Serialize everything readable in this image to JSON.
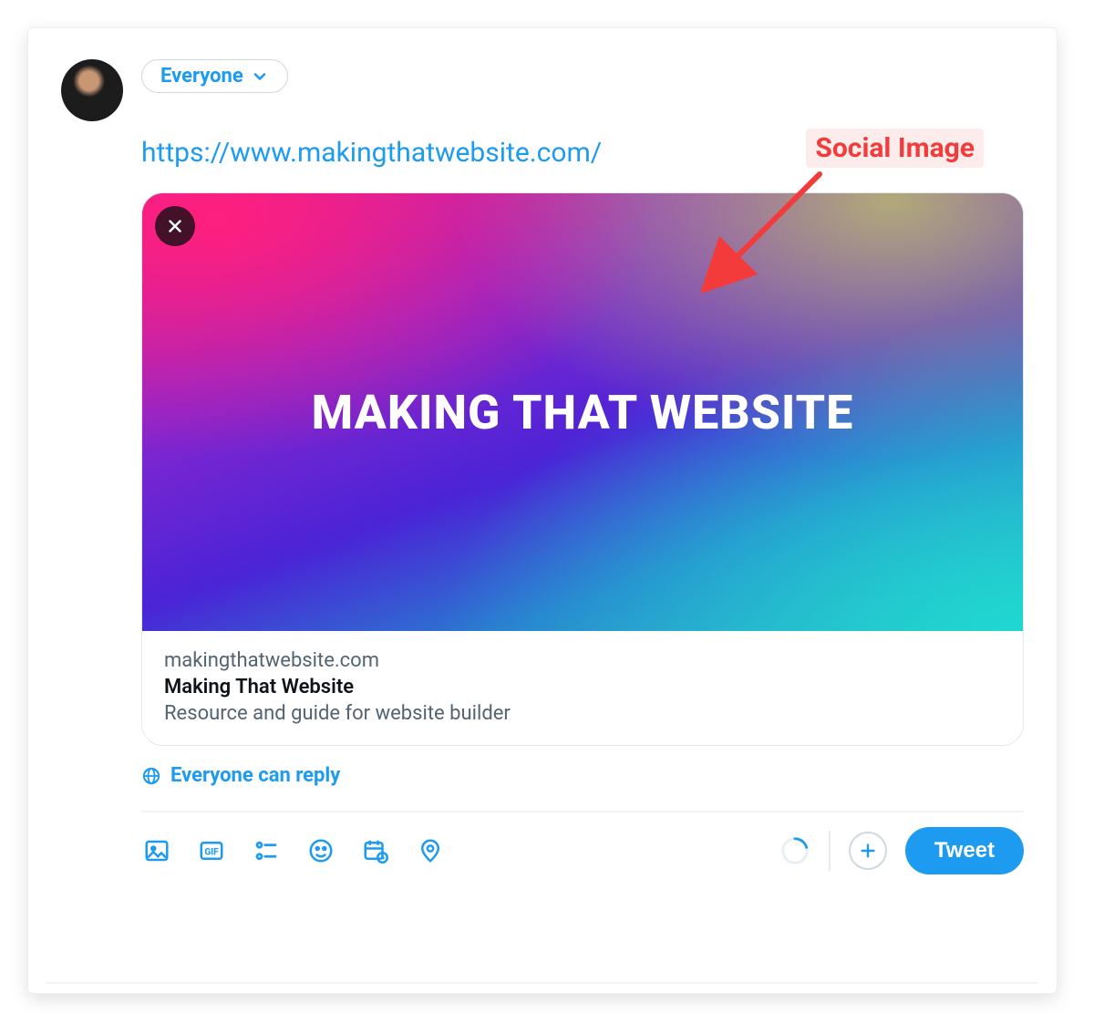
{
  "composer": {
    "audience_label": "Everyone",
    "tweet_url": "https://www.makingthatwebsite.com/",
    "reply_label": "Everyone can reply",
    "tweet_button": "Tweet"
  },
  "link_card": {
    "hero_text": "MAKING THAT WEBSITE",
    "domain": "makingthatwebsite.com",
    "title": "Making That Website",
    "description": "Resource and guide for website builder"
  },
  "toolbar_icons": {
    "media": "media-icon",
    "gif": "gif-icon",
    "poll": "poll-icon",
    "emoji": "emoji-icon",
    "schedule": "schedule-icon",
    "location": "location-icon"
  },
  "annotation": {
    "label": "Social Image"
  },
  "colors": {
    "accent": "#1d9bf0",
    "text_muted": "#536471",
    "annotation": "#f33b3b"
  }
}
